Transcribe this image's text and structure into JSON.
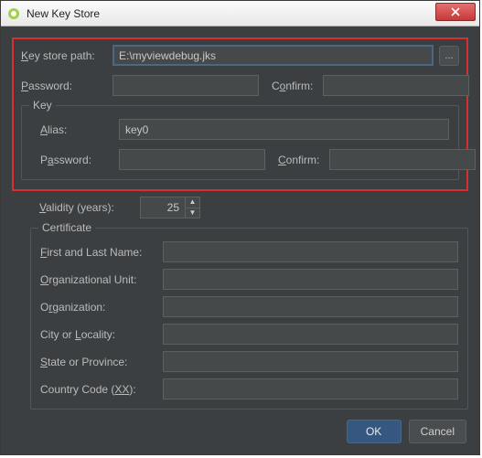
{
  "window": {
    "title": "New Key Store"
  },
  "keystore": {
    "path_label": "Key store path:",
    "path_value": "E:\\myviewdebug.jks",
    "browse": "...",
    "password_label": "Password:",
    "password_value": "",
    "confirm_label": "Confirm:",
    "confirm_value": ""
  },
  "key": {
    "group_title": "Key",
    "alias_label": "Alias:",
    "alias_value": "key0",
    "password_label": "Password:",
    "password_value": "",
    "confirm_label": "Confirm:",
    "confirm_value": "",
    "validity_label": "Validity (years):",
    "validity_value": "25"
  },
  "certificate": {
    "group_title": "Certificate",
    "first_last": "First and Last Name:",
    "first_last_value": "",
    "org_unit": "Organizational Unit:",
    "org_unit_value": "",
    "org": "Organization:",
    "org_value": "",
    "city": "City or Locality:",
    "city_value": "",
    "state": "State or Province:",
    "state_value": "",
    "country": "Country Code (XX):",
    "country_value": ""
  },
  "buttons": {
    "ok": "OK",
    "cancel": "Cancel"
  }
}
